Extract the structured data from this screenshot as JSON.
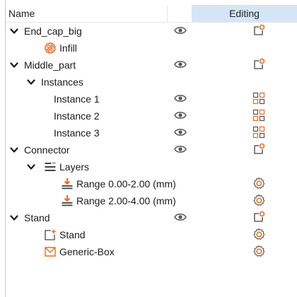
{
  "header": {
    "name_label": "Name",
    "editing_label": "Editing"
  },
  "rows": [
    {
      "label": "End_cap_big",
      "depth": 0,
      "expander": true,
      "type_icon": "",
      "visible": true,
      "edit_icon": "object-edit-icon"
    },
    {
      "label": "Infill",
      "depth": 1,
      "expander": false,
      "type_icon": "infill-icon",
      "visible": false,
      "edit_icon": ""
    },
    {
      "label": "Middle_part",
      "depth": 0,
      "expander": true,
      "type_icon": "",
      "visible": true,
      "edit_icon": "object-edit-icon"
    },
    {
      "label": "Instances",
      "depth": 1,
      "expander": true,
      "type_icon": "",
      "visible": false,
      "edit_icon": ""
    },
    {
      "label": "Instance 1",
      "depth": 2,
      "expander": false,
      "type_icon": "",
      "visible": true,
      "edit_icon": "instance-grid-icon"
    },
    {
      "label": "Instance 2",
      "depth": 2,
      "expander": false,
      "type_icon": "",
      "visible": true,
      "edit_icon": "instance-grid-icon"
    },
    {
      "label": "Instance 3",
      "depth": 2,
      "expander": false,
      "type_icon": "",
      "visible": true,
      "edit_icon": "instance-grid-icon"
    },
    {
      "label": "Connector",
      "depth": 0,
      "expander": true,
      "type_icon": "",
      "visible": true,
      "edit_icon": "object-edit-icon"
    },
    {
      "label": "Layers",
      "depth": 1,
      "expander": true,
      "type_icon": "layers-icon",
      "visible": false,
      "edit_icon": ""
    },
    {
      "label": "Range 0.00-2.00 (mm)",
      "depth": 2,
      "expander": false,
      "type_icon": "range-icon",
      "visible": false,
      "edit_icon": "settings-gear-icon"
    },
    {
      "label": "Range 2.00-4.00 (mm)",
      "depth": 2,
      "expander": false,
      "type_icon": "range-icon",
      "visible": false,
      "edit_icon": "settings-gear-icon"
    },
    {
      "label": "Stand",
      "depth": 0,
      "expander": true,
      "type_icon": "",
      "visible": true,
      "edit_icon": "object-edit-icon"
    },
    {
      "label": "Stand",
      "depth": 1,
      "expander": false,
      "type_icon": "part-add-icon",
      "visible": false,
      "edit_icon": "settings-gear-icon"
    },
    {
      "label": "Generic-Box",
      "depth": 1,
      "expander": false,
      "type_icon": "box-icon",
      "visible": false,
      "edit_icon": "settings-gear-icon"
    }
  ],
  "colors": {
    "accent": "#ed6b21",
    "header_selected": "#d4e6f6",
    "icon_gray": "#555555"
  }
}
